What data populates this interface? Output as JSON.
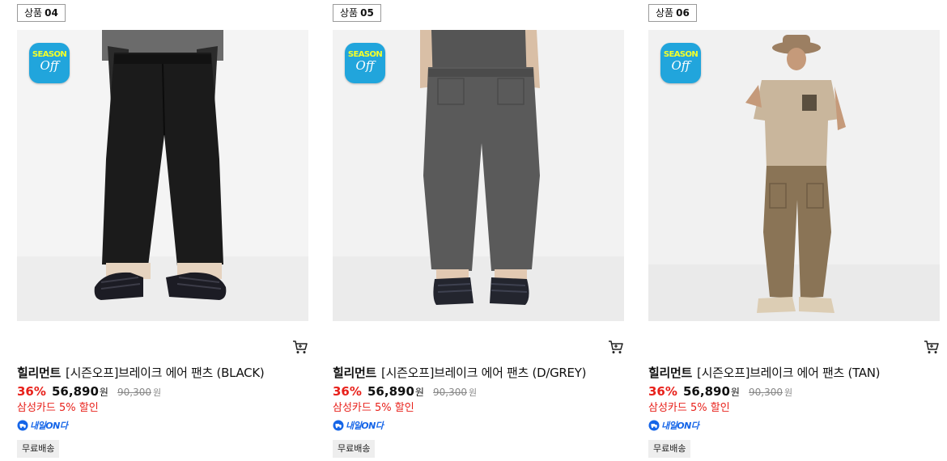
{
  "products": [
    {
      "badge_prefix": "상품",
      "badge_num": "04",
      "season_line1": "SEASON",
      "season_line2": "Off",
      "brand": "힐리먼트",
      "name": "[시즌오프]브레이크 에어 팬츠 (BLACK)",
      "discount_rate": "36%",
      "sale_price": "56,890",
      "sale_unit": "원",
      "original_price": "90,300",
      "original_unit": "원",
      "card_promo": "삼성카드 5% 할인",
      "delivery_label": "내일ON다",
      "free_shipping": "무료배송",
      "pants_color": "#1b1b1b",
      "shirt_color": "#6b6b6b"
    },
    {
      "badge_prefix": "상품",
      "badge_num": "05",
      "season_line1": "SEASON",
      "season_line2": "Off",
      "brand": "힐리먼트",
      "name": "[시즌오프]브레이크 에어 팬츠 (D/GREY)",
      "discount_rate": "36%",
      "sale_price": "56,890",
      "sale_unit": "원",
      "original_price": "90,300",
      "original_unit": "원",
      "card_promo": "삼성카드 5% 할인",
      "delivery_label": "내일ON다",
      "free_shipping": "무료배송",
      "pants_color": "#5a5a5a",
      "shirt_color": "#555555"
    },
    {
      "badge_prefix": "상품",
      "badge_num": "06",
      "season_line1": "SEASON",
      "season_line2": "Off",
      "brand": "힐리먼트",
      "name": "[시즌오프]브레이크 에어 팬츠 (TAN)",
      "discount_rate": "36%",
      "sale_price": "56,890",
      "sale_unit": "원",
      "original_price": "90,300",
      "original_unit": "원",
      "card_promo": "삼성카드 5% 할인",
      "delivery_label": "내일ON다",
      "free_shipping": "무료배송",
      "pants_color": "#8a7456",
      "shirt_color": "#c9b69c"
    }
  ],
  "icons": {
    "cart": "cart-icon",
    "delivery": "truck-icon"
  },
  "colors": {
    "discount": "#e8211b",
    "delivery": "#1565e8",
    "season_badge_bg": "#21a5dc",
    "season_badge_text": "#f4ff29"
  }
}
